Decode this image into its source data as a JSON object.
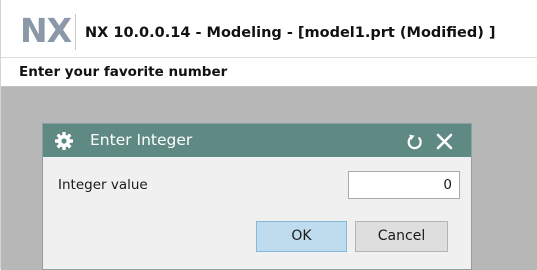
{
  "app": {
    "logo_text": "NX",
    "window_title": "NX 10.0.0.14 - Modeling - [model1.prt (Modified) ]"
  },
  "cue_line": {
    "text": "Enter your favorite number"
  },
  "dialog": {
    "title": "Enter Integer",
    "icons": {
      "dialog_icon": "gear-icon",
      "reset": "reset-icon",
      "close": "close-icon"
    },
    "field": {
      "label": "Integer value",
      "value": "0"
    },
    "buttons": {
      "ok_label": "OK",
      "cancel_label": "Cancel"
    }
  },
  "colors": {
    "dialog_header": "#5e8a83",
    "graphics_background": "#b7b7b7",
    "ok_button": "#bfdcee",
    "logo": "#8a98a8"
  }
}
